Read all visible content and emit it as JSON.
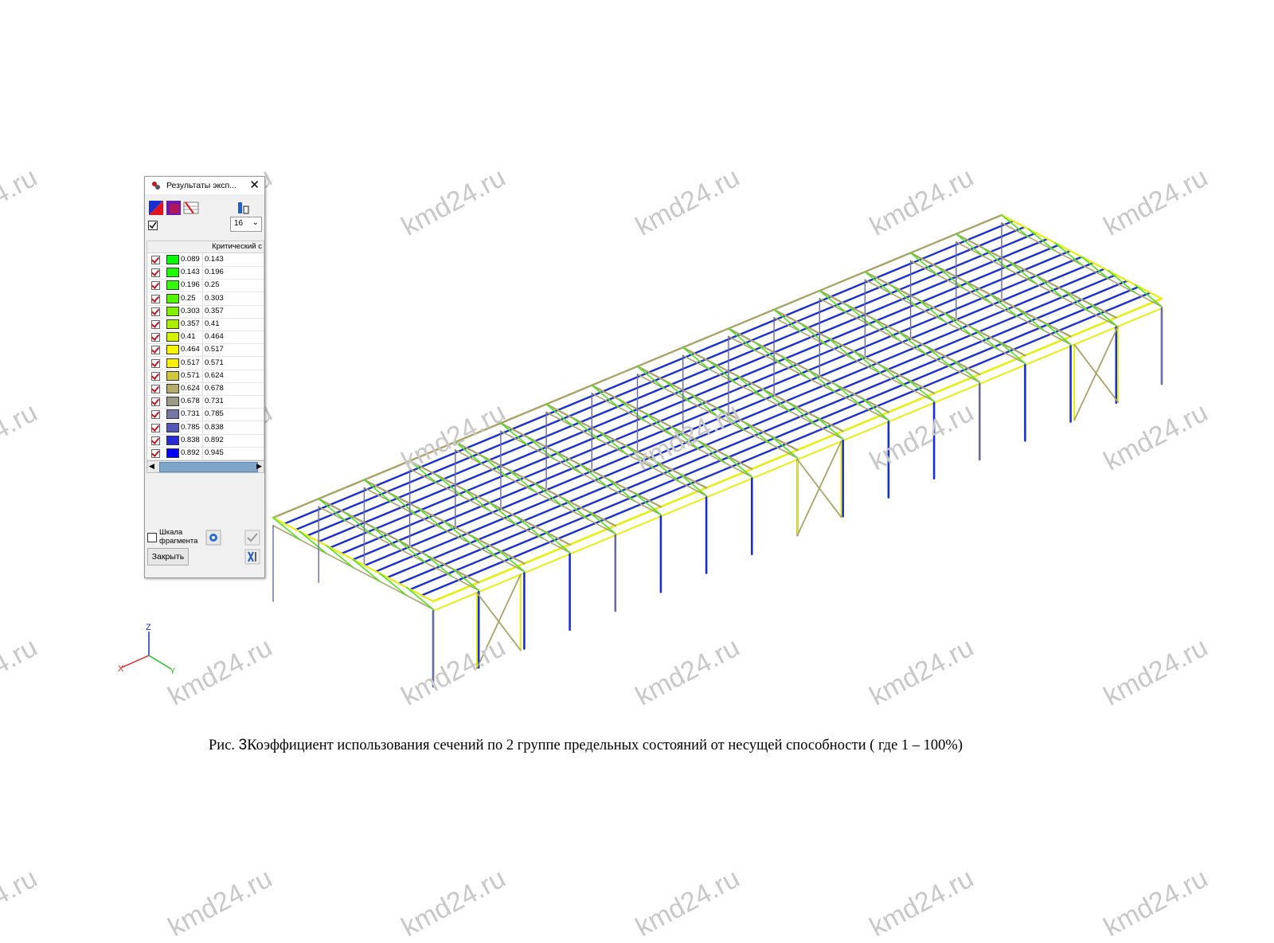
{
  "watermark_text": "kmd24.ru",
  "panel": {
    "title": "Результаты эксп...",
    "close_glyph": "✕",
    "column_header": "Критический с",
    "count_value": "16",
    "scale_label_line1": "Шкала",
    "scale_label_line2": "фрагмента",
    "close_button": "Закрыть",
    "legend": [
      {
        "from": "0.089",
        "to": "0.143",
        "color": "#00ff00"
      },
      {
        "from": "0.143",
        "to": "0.196",
        "color": "#19ff00"
      },
      {
        "from": "0.196",
        "to": "0.25",
        "color": "#33ff00"
      },
      {
        "from": "0.25",
        "to": "0.303",
        "color": "#55f500"
      },
      {
        "from": "0.303",
        "to": "0.357",
        "color": "#80f000"
      },
      {
        "from": "0.357",
        "to": "0.41",
        "color": "#aaf000"
      },
      {
        "from": "0.41",
        "to": "0.464",
        "color": "#d4f200"
      },
      {
        "from": "0.464",
        "to": "0.517",
        "color": "#f5f500"
      },
      {
        "from": "0.517",
        "to": "0.571",
        "color": "#ffef00"
      },
      {
        "from": "0.571",
        "to": "0.624",
        "color": "#cfc83a"
      },
      {
        "from": "0.624",
        "to": "0.678",
        "color": "#b6ac6a"
      },
      {
        "from": "0.678",
        "to": "0.731",
        "color": "#9a9a86"
      },
      {
        "from": "0.731",
        "to": "0.785",
        "color": "#7777a6"
      },
      {
        "from": "0.785",
        "to": "0.838",
        "color": "#5555b8"
      },
      {
        "from": "0.838",
        "to": "0.892",
        "color": "#2a2ad2"
      },
      {
        "from": "0.892",
        "to": "0.945",
        "color": "#0000ff"
      }
    ]
  },
  "axes": {
    "x": "X",
    "y": "Y",
    "z": "Z"
  },
  "caption": {
    "prefix": "Рис. ",
    "number": "3",
    "text": "Коэффициент использования сечений по 2 группе предельных состояний от несущей способности ( где 1 – 100%)"
  },
  "colors": {
    "blue": "#1a2fd0",
    "khaki": "#a8a468",
    "yellow": "#e6ef10",
    "green": "#4fe21a",
    "grey_blue": "#6a6aa8"
  }
}
